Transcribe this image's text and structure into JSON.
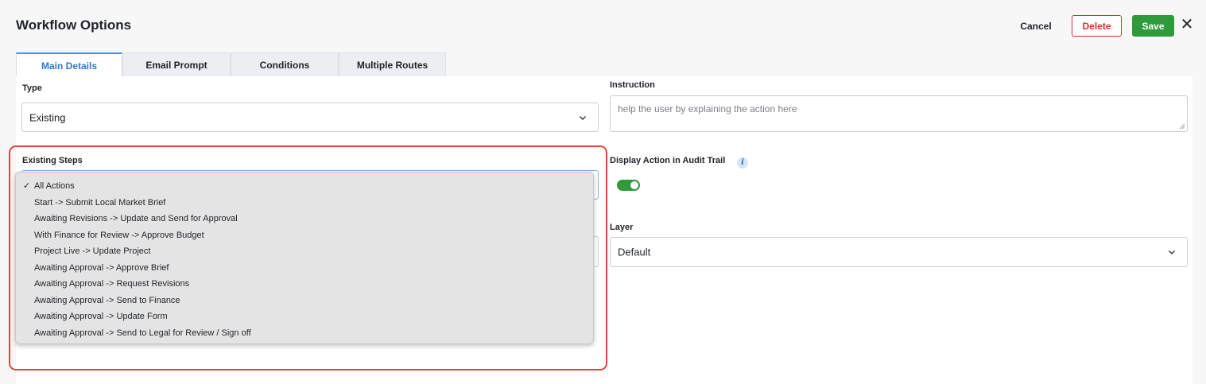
{
  "header": {
    "title": "Workflow Options",
    "cancel_label": "Cancel",
    "delete_label": "Delete",
    "save_label": "Save",
    "close_glyph": "✕"
  },
  "tabs": [
    {
      "label": "Main Details",
      "active": true
    },
    {
      "label": "Email Prompt",
      "active": false
    },
    {
      "label": "Conditions",
      "active": false
    },
    {
      "label": "Multiple Routes",
      "active": false
    }
  ],
  "form": {
    "type_label": "Type",
    "type_value": "Existing",
    "instruction_label": "Instruction",
    "instruction_placeholder": "help the user by explaining the action here",
    "existing_steps_label": "Existing Steps",
    "audit_trail_label": "Display Action in Audit Trail",
    "audit_trail_enabled": true,
    "info_glyph": "i",
    "layer_label": "Layer",
    "layer_value": "Default"
  },
  "dropdown": {
    "check_glyph": "✓",
    "options": [
      {
        "label": "All Actions",
        "selected": true
      },
      {
        "label": "Start -> Submit Local Market Brief",
        "selected": false
      },
      {
        "label": "Awaiting Revisions -> Update and Send for Approval",
        "selected": false
      },
      {
        "label": "With Finance for Review -> Approve Budget",
        "selected": false
      },
      {
        "label": "Project Live -> Update Project",
        "selected": false
      },
      {
        "label": "Awaiting Approval -> Approve Brief",
        "selected": false
      },
      {
        "label": "Awaiting Approval -> Request Revisions",
        "selected": false
      },
      {
        "label": "Awaiting Approval -> Send to Finance",
        "selected": false
      },
      {
        "label": "Awaiting Approval -> Update Form",
        "selected": false
      },
      {
        "label": "Awaiting Approval -> Send to Legal for Review / Sign off",
        "selected": false
      }
    ]
  },
  "colors": {
    "accent_blue": "#2f7ad1",
    "save_green": "#2e9a3a",
    "delete_red": "#d32f2f",
    "highlight_red": "#d9483b"
  }
}
